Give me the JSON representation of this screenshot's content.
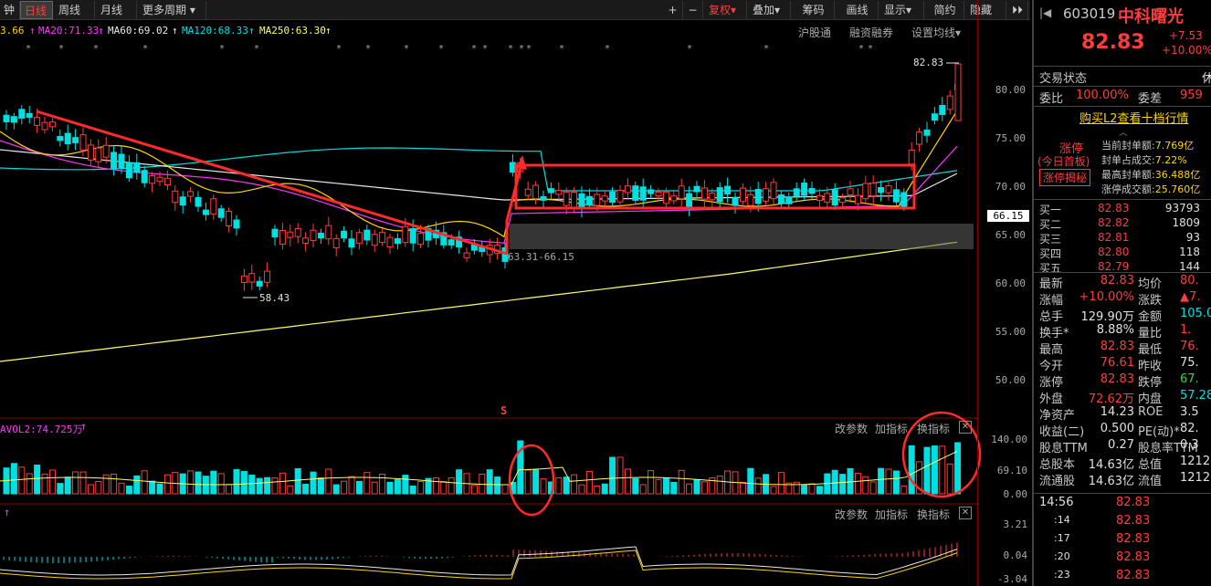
{
  "toolbar": {
    "tabs": [
      "钟",
      "日线",
      "周线",
      "月线",
      "更多周期"
    ],
    "right_buttons": [
      "复权",
      "叠加",
      "筹码",
      "画线",
      "显示",
      "简约",
      "隐藏"
    ]
  },
  "ma_legend": {
    "ma10": "3.66",
    "ma20": "MA20:71.33",
    "ma60": "MA60:69.02",
    "ma120": "MA120:68.33",
    "ma250": "MA250:63.30",
    "links": [
      "沪股通",
      "融资融券",
      "设置均线"
    ]
  },
  "price_axis": [
    "80.00",
    "75.00",
    "70.00",
    "66.15",
    "65.00",
    "60.00",
    "55.00",
    "50.00"
  ],
  "annotations": {
    "high_label": "82.83",
    "low_label": "58.43",
    "zone_label": "63.31-66.15",
    "s_marker": "S"
  },
  "volume_panel": {
    "title": "AVOL2:74.725万",
    "buttons": [
      "改参数",
      "加指标",
      "换指标"
    ],
    "axis": [
      "140.00",
      "69.10",
      "0.00"
    ]
  },
  "macd_panel": {
    "buttons": [
      "改参数",
      "加指标",
      "换指标"
    ],
    "axis": [
      "3.21",
      "0.04",
      "-3.04"
    ]
  },
  "side": {
    "code": "603019",
    "name": "中科曙光",
    "price": "82.83",
    "change": "+7.53",
    "change_pct": "+10.00%",
    "status_label": "交易状态",
    "status_value": "休",
    "weibi_label": "委比",
    "weibi_value": "100.00%",
    "weicha_label": "委差",
    "weicha_value": "959",
    "l2_link": "购买L2查看十档行情",
    "limit_title": "涨停",
    "limit_sub": "(今日首板)",
    "limit_btn": "涨停揭秘",
    "seal_stats": [
      {
        "label": "当前封单额:",
        "value": "7.769亿"
      },
      {
        "label": "封单占成交:",
        "value": "7.22%"
      },
      {
        "label": "最高封单额:",
        "value": "36.488亿"
      },
      {
        "label": "涨停成交额:",
        "value": "25.760亿"
      }
    ],
    "bids": [
      {
        "label": "买一",
        "price": "82.83",
        "vol": "93793"
      },
      {
        "label": "买二",
        "price": "82.82",
        "vol": "1809"
      },
      {
        "label": "买三",
        "price": "82.81",
        "vol": "93"
      },
      {
        "label": "买四",
        "price": "82.80",
        "vol": "118"
      },
      {
        "label": "买五",
        "price": "82.79",
        "vol": "144"
      }
    ],
    "stats": [
      {
        "l1": "最新",
        "v1": "82.83",
        "l2": "均价",
        "v2": "80."
      },
      {
        "l1": "涨幅",
        "v1": "+10.00%",
        "l2": "涨跌",
        "v2": "▲7."
      },
      {
        "l1": "总手",
        "v1": "129.90万",
        "l2": "金额",
        "v2": "105.0"
      },
      {
        "l1": "换手*",
        "v1": "8.88%",
        "l2": "量比",
        "v2": "1."
      },
      {
        "l1": "最高",
        "v1": "82.83",
        "l2": "最低",
        "v2": "76."
      },
      {
        "l1": "今开",
        "v1": "76.61",
        "l2": "昨收",
        "v2": "75."
      },
      {
        "l1": "涨停",
        "v1": "82.83",
        "l2": "跌停",
        "v2": "67."
      },
      {
        "l1": "外盘",
        "v1": "72.62万",
        "l2": "内盘",
        "v2": "57.28"
      },
      {
        "l1": "净资产",
        "v1": "14.23",
        "l2": "ROE",
        "v2": "3.5"
      },
      {
        "l1": "收益(二)",
        "v1": "0.500",
        "l2": "PE(动)*",
        "v2": "82."
      },
      {
        "l1": "股息TTM",
        "v1": "0.27",
        "l2": "股息率TTM",
        "v2": "0.3"
      },
      {
        "l1": "总股本",
        "v1": "14.63亿",
        "l2": "总值",
        "v2": "1212"
      },
      {
        "l1": "流通股",
        "v1": "14.63亿",
        "l2": "流值",
        "v2": "1212"
      }
    ],
    "ticks": [
      {
        "time": "14:56",
        "price": "82.83"
      },
      {
        "time": ":14",
        "price": "82.83"
      },
      {
        "time": ":17",
        "price": "82.83"
      },
      {
        "time": ":20",
        "price": "82.83"
      },
      {
        "time": ":23",
        "price": "82.83"
      }
    ]
  }
}
